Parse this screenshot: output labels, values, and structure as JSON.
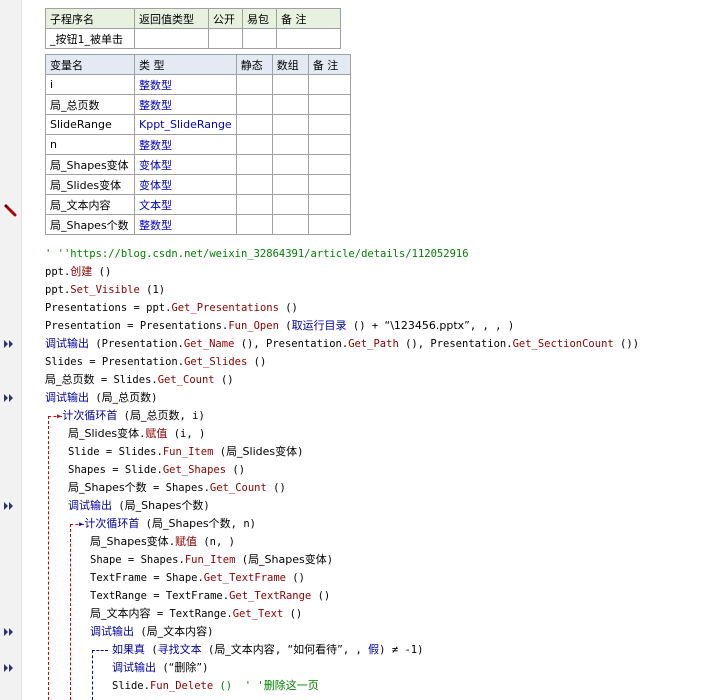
{
  "sub_table": {
    "headers": [
      "子程序名",
      "返回值类型",
      "公开",
      "易包",
      "备 注"
    ],
    "row": [
      "_按钮1_被单击",
      "",
      "",
      "",
      ""
    ]
  },
  "var_table": {
    "headers": [
      "变量名",
      "类 型",
      "静态",
      "数组",
      "备 注"
    ],
    "rows": [
      [
        "i",
        "整数型"
      ],
      [
        "局_总页数",
        "整数型"
      ],
      [
        "SlideRange",
        "Kppt_SlideRange"
      ],
      [
        "n",
        "整数型"
      ],
      [
        "局_Shapes变体",
        "变体型"
      ],
      [
        "局_Slides变体",
        "变体型"
      ],
      [
        "局_文本内容",
        "文本型"
      ],
      [
        "局_Shapes个数",
        "整数型"
      ]
    ]
  },
  "code": {
    "l1": "' ''https://blog.csdn.net/weixin_32864391/article/details/112052916",
    "l2a": "ppt.",
    "l2b": "创建",
    "l2c": " ()",
    "l3a": "ppt.",
    "l3b": "Set_Visible",
    "l3c": " (1)",
    "l4a": "Presentations = ppt.",
    "l4b": "Get_Presentations",
    "l4c": " ()",
    "l5a": "Presentation = Presentations.",
    "l5b": "Fun_Open",
    "l5c": " (",
    "l5d": "取运行目录",
    "l5e": " () + ",
    "l5f": "“\\123456.pptx”",
    "l5g": ", , , )",
    "l6a": "调试输出",
    "l6b": " (Presentation.",
    "l6c": "Get_Name",
    "l6d": " (), Presentation.",
    "l6e": "Get_Path",
    "l6f": " (), Presentation.",
    "l6g": "Get_SectionCount",
    "l6h": " ())",
    "l7a": "Slides = Presentation.",
    "l7b": "Get_Slides",
    "l7c": " ()",
    "l8a": "局_总页数",
    "l8b": " = Slides.",
    "l8c": "Get_Count",
    "l8d": " ()",
    "l9a": "调试输出",
    "l9b": " (",
    "l9c": "局_总页数",
    "l9d": ")",
    "l10a": "计次循环首",
    "l10b": " (",
    "l10c": "局_总页数",
    "l10d": ", i)",
    "l11a": "局_Slides变体",
    "l11b": ".",
    "l11c": "赋值",
    "l11d": " (i, )",
    "l12a": "Slide = Slides.",
    "l12b": "Fun_Item",
    "l12c": " (",
    "l12d": "局_Slides变体",
    "l12e": ")",
    "l13a": "Shapes = Slide.",
    "l13b": "Get_Shapes",
    "l13c": " ()",
    "l14a": "局_Shapes个数",
    "l14b": " = Shapes.",
    "l14c": "Get_Count",
    "l14d": " ()",
    "l15a": "调试输出",
    "l15b": " (",
    "l15c": "局_Shapes个数",
    "l15d": ")",
    "l16a": "计次循环首",
    "l16b": " (",
    "l16c": "局_Shapes个数",
    "l16d": ", n)",
    "l17a": "局_Shapes变体",
    "l17b": ".",
    "l17c": "赋值",
    "l17d": " (n, )",
    "l18a": "Shape = Shapes.",
    "l18b": "Fun_Item",
    "l18c": " (",
    "l18d": "局_Shapes变体",
    "l18e": ")",
    "l19a": "TextFrame = Shape.",
    "l19b": "Get_TextFrame",
    "l19c": " ()",
    "l20a": "TextRange = TextFrame.",
    "l20b": "Get_TextRange",
    "l20c": " ()",
    "l21a": "局_文本内容",
    "l21b": " = TextRange.",
    "l21c": "Get_Text",
    "l21d": " ()",
    "l22a": "调试输出",
    "l22b": " (",
    "l22c": "局_文本内容",
    "l22d": ")",
    "l23a": "如果真",
    "l23b": " (",
    "l23c": "寻找文本",
    "l23d": " (",
    "l23e": "局_文本内容",
    "l23f": ", ",
    "l23g": "“如何看待”",
    "l23h": ", , ",
    "l23i": "假",
    "l23j": ") ≠ -1)",
    "l24a": "调试输出",
    "l24b": " (",
    "l24c": "“删除”",
    "l24d": ")",
    "l25a": "Slide.",
    "l25b": "Fun_Delete",
    "l25c": " ()  ' '",
    "l25d": "删除这一页"
  },
  "colors": {
    "function": "#8b0000",
    "keyword": "#0000a0",
    "string": "#008000",
    "loop_line": "#d00000",
    "if_line": "#0000c0"
  }
}
